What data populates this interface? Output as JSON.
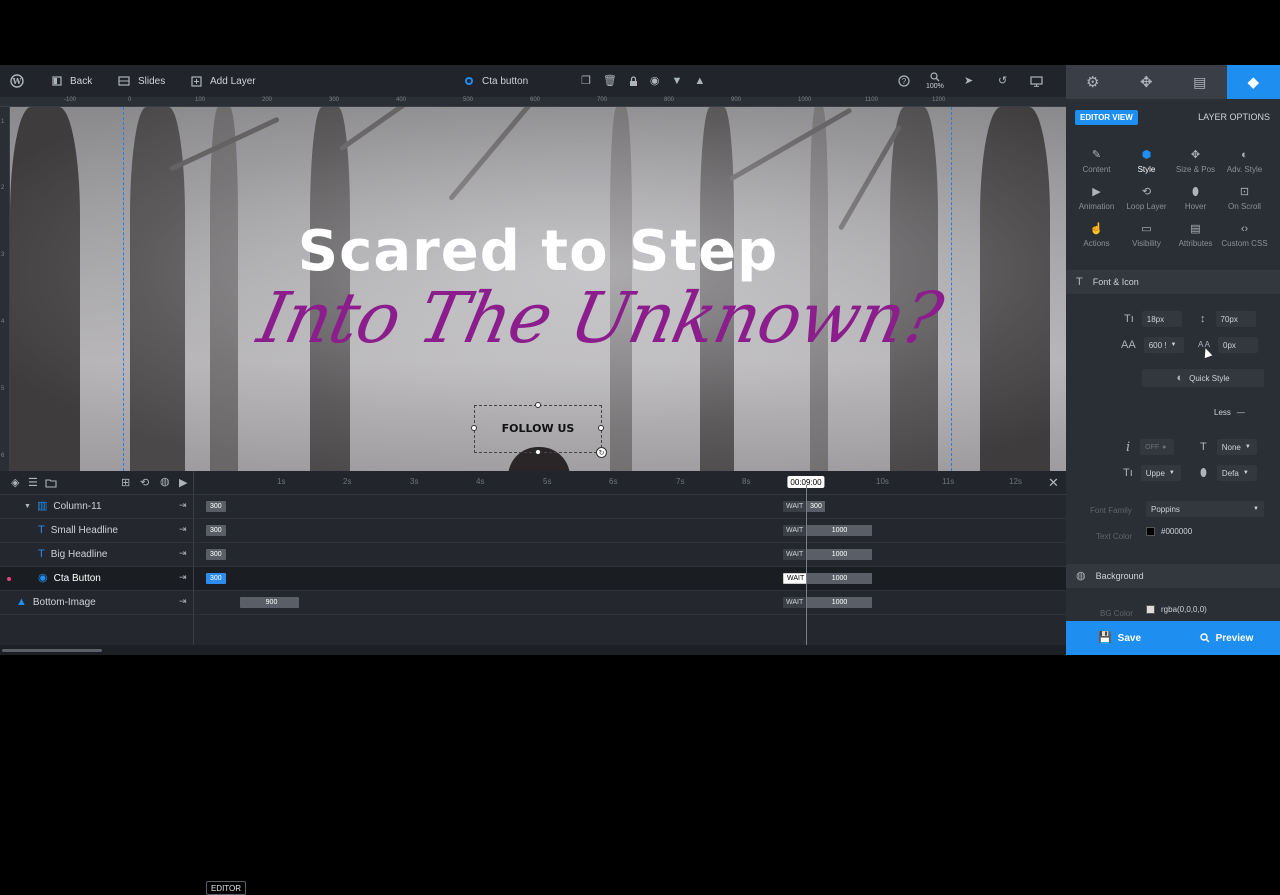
{
  "toolbar": {
    "back_label": "Back",
    "slides_label": "Slides",
    "add_layer_label": "Add Layer",
    "selected_layer": "Cta button",
    "zoom": "100%"
  },
  "ruler": {
    "top_labels": [
      "-100",
      "0",
      "100",
      "200",
      "300",
      "400",
      "500",
      "600",
      "700",
      "800",
      "900",
      "1000",
      "1100",
      "1200"
    ],
    "left_labels": [
      "1",
      "2",
      "3",
      "4",
      "5",
      "6"
    ]
  },
  "canvas": {
    "headline": "Scared to Step",
    "script_headline": "Into The Unknown?",
    "cta_text": "FOLLOW US"
  },
  "timeline": {
    "editor_label": "EDITOR",
    "current_time": "00:09:00",
    "ticks": [
      "1s",
      "2s",
      "3s",
      "4s",
      "5s",
      "6s",
      "7s",
      "8s",
      "10s",
      "11s",
      "12s"
    ],
    "rows": [
      {
        "name": "Column-11",
        "start": "300",
        "wait": "WAIT",
        "end": "300"
      },
      {
        "name": "Small Headline",
        "start": "300",
        "wait": "WAIT",
        "end": "1000"
      },
      {
        "name": "Big Headline",
        "start": "300",
        "wait": "WAIT",
        "end": "1000"
      },
      {
        "name": "Cta Button",
        "start": "300",
        "wait": "WAIT",
        "end": "1000"
      },
      {
        "name": "Bottom-Image",
        "start": "900",
        "wait": "WAIT",
        "end": "1000"
      }
    ]
  },
  "panel": {
    "editor_view": "EDITOR VIEW",
    "layer_options": "LAYER OPTIONS",
    "options": [
      "Content",
      "Style",
      "Size & Pos",
      "Adv. Style",
      "Animation",
      "Loop Layer",
      "Hover",
      "On Scroll",
      "Actions",
      "Visibility",
      "Attributes",
      "Custom CSS"
    ],
    "font_section": "Font & Icon",
    "font_size": "18px",
    "line_height": "70px",
    "font_weight": "600 !",
    "letter_spacing": "0px",
    "quick_style": "Quick Style",
    "less": "Less",
    "italic_toggle": "OFF",
    "text_decoration": "None",
    "text_transform": "Uppe",
    "cursor": "Defa",
    "font_family_label": "Font Family",
    "font_family": "Poppins",
    "text_color_label": "Text Color",
    "text_color": "#000000",
    "background_section": "Background",
    "bg_color_label": "BG Color",
    "bg_color": "rgba(0,0,0,0)",
    "save": "Save",
    "preview": "Preview"
  },
  "colors": {
    "accent": "#1f8ef1",
    "script": "#8b1d8c"
  }
}
